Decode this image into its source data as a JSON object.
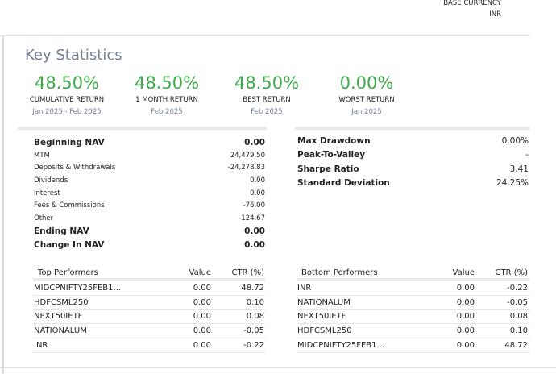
{
  "base_currency": {
    "label": "BASE CURRENCY",
    "value": "INR"
  },
  "title": "Key Statistics",
  "kpis": [
    {
      "value": "48.50%",
      "label": "CUMULATIVE RETURN",
      "period": "Jan 2025 - Feb 2025"
    },
    {
      "value": "48.50%",
      "label": "1 MONTH RETURN",
      "period": "Feb 2025"
    },
    {
      "value": "48.50%",
      "label": "BEST RETURN",
      "period": "Feb 2025"
    },
    {
      "value": "0.00%",
      "label": "WORST RETURN",
      "period": "Jan 2025"
    }
  ],
  "nav": {
    "rows": [
      {
        "label": "Beginning NAV",
        "value": "0.00",
        "style": "big"
      },
      {
        "label": "MTM",
        "value": "24,479.50",
        "style": "small"
      },
      {
        "label": "Deposits & Withdrawals",
        "value": "-24,278.83",
        "style": "small"
      },
      {
        "label": "Dividends",
        "value": "0.00",
        "style": "small"
      },
      {
        "label": "Interest",
        "value": "0.00",
        "style": "small"
      },
      {
        "label": "Fees & Commissions",
        "value": "-76.00",
        "style": "small"
      },
      {
        "label": "Other",
        "value": "-124.67",
        "style": "small"
      },
      {
        "label": "Ending NAV",
        "value": "0.00",
        "style": "big"
      },
      {
        "label": "Change In NAV",
        "value": "0.00",
        "style": "big"
      }
    ]
  },
  "risk": {
    "rows": [
      {
        "label": "Max Drawdown",
        "value": "0.00%"
      },
      {
        "label": "Peak-To-Valley",
        "value": "-"
      },
      {
        "label": "Sharpe Ratio",
        "value": "3.41"
      },
      {
        "label": "Standard Deviation",
        "value": "24.25%"
      }
    ]
  },
  "top_performers": {
    "headers": {
      "name": "Top Performers",
      "value": "Value",
      "ctr": "CTR (%)"
    },
    "rows": [
      {
        "name": "MIDCPNIFTY25FEB1...",
        "value": "0.00",
        "ctr": "48.72"
      },
      {
        "name": "HDFCSML250",
        "value": "0.00",
        "ctr": "0.10"
      },
      {
        "name": "NEXT50IETF",
        "value": "0.00",
        "ctr": "0.08"
      },
      {
        "name": "NATIONALUM",
        "value": "0.00",
        "ctr": "-0.05"
      },
      {
        "name": "INR",
        "value": "0.00",
        "ctr": "-0.22"
      }
    ]
  },
  "bottom_performers": {
    "headers": {
      "name": "Bottom Performers",
      "value": "Value",
      "ctr": "CTR (%)"
    },
    "rows": [
      {
        "name": "INR",
        "value": "0.00",
        "ctr": "-0.22"
      },
      {
        "name": "NATIONALUM",
        "value": "0.00",
        "ctr": "-0.05"
      },
      {
        "name": "NEXT50IETF",
        "value": "0.00",
        "ctr": "0.08"
      },
      {
        "name": "HDFCSML250",
        "value": "0.00",
        "ctr": "0.10"
      },
      {
        "name": "MIDCPNIFTY25FEB1...",
        "value": "0.00",
        "ctr": "48.72"
      }
    ]
  }
}
